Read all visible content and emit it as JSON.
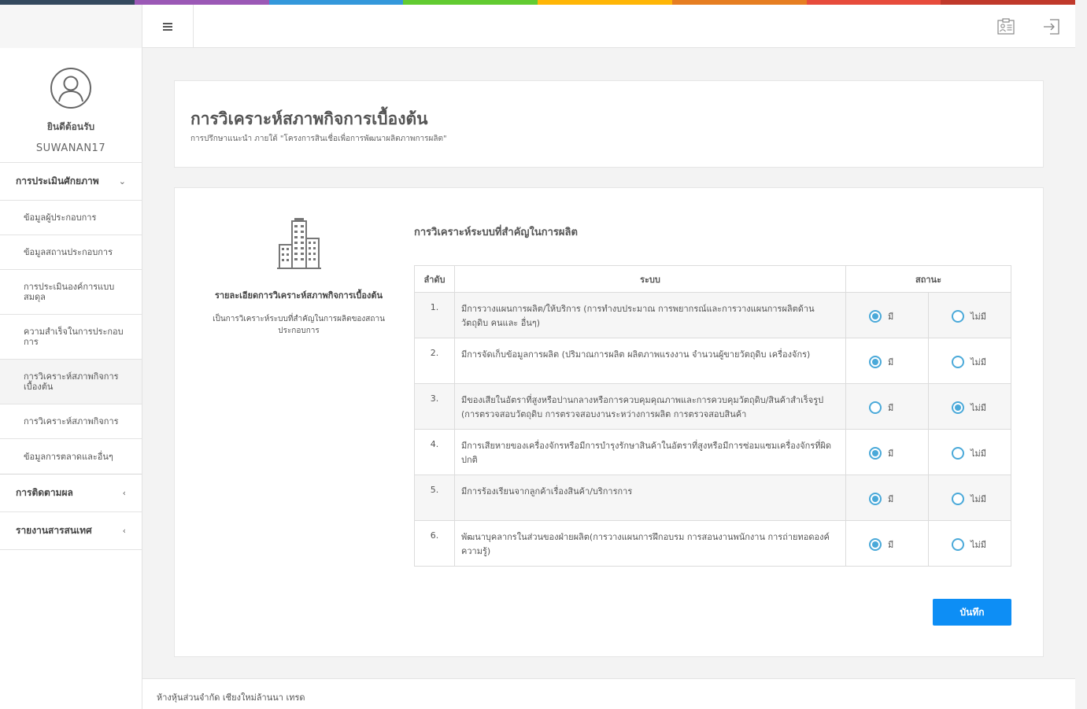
{
  "colors": {
    "stripe": [
      "#34495e",
      "#9b59b6",
      "#3498db",
      "#62cb31",
      "#ffb606",
      "#e67e22",
      "#e74c3c",
      "#c0392b"
    ],
    "accent": "#0d8ef5",
    "radio": "#4aa9d9"
  },
  "header": {
    "menu_icon": "hamburger-icon",
    "contact_icon": "id-card-icon",
    "logout_icon": "logout-icon"
  },
  "sidebar": {
    "welcome": "ยินดีต้อนรับ",
    "username": "SUWANAN17",
    "groups": [
      {
        "label": "การประเมินศักยภาพ",
        "chevron": "⌄",
        "items": [
          {
            "label": "ข้อมูลผู้ประกอบการ"
          },
          {
            "label": "ข้อมูลสถานประกอบการ"
          },
          {
            "label": "การประเมินองค์การแบบสมดุล"
          },
          {
            "label": "ความสำเร็จในการประกอบการ"
          },
          {
            "label": "การวิเคราะห์สภาพกิจการเบื้องต้น"
          },
          {
            "label": "การวิเคราะห์สภาพกิจการ"
          },
          {
            "label": "ข้อมูลการตลาดและอื่นๆ"
          }
        ]
      },
      {
        "label": "การติดตามผล",
        "chevron": "‹"
      },
      {
        "label": "รายงานสารสนเทศ",
        "chevron": "‹"
      }
    ]
  },
  "page": {
    "title": "การวิเคราะห์สภาพกิจการเบื้องต้น",
    "subtitle": "การปรึกษาแนะนำ ภายใต้ \"โครงการสินเชื่อเพื่อการพัฒนาผลิตภาพการผลิต\""
  },
  "detail": {
    "title": "รายละเอียดการวิเคราะห์สภาพกิจการเบื้องต้น",
    "description": "เป็นการวิเคราะห์ระบบที่สำคัญในการผลิตของสถานประกอบการ"
  },
  "section_title": "การวิเคราะห์ระบบที่สำคัญในการผลิต",
  "table": {
    "headers": {
      "order": "ลำดับ",
      "system": "ระบบ",
      "status": "สถานะ"
    },
    "yes_label": "มี",
    "no_label": "ไม่มี",
    "rows": [
      {
        "num": "1.",
        "text": "มีการวางแผนการผลิต/ให้บริการ (การทำงบประมาณ การพยากรณ์และการวางแผนการผลิตด้าน วัตถุดิบ คนและ อื่นๆ)",
        "selected": "yes"
      },
      {
        "num": "2.",
        "text": "มีการจัดเก็บข้อมูลการผลิต (ปริมาณการผลิต ผลิตภาพแรงงาน จำนวนผู้ขายวัตถุดิบ เครื่องจักร)",
        "selected": "yes"
      },
      {
        "num": "3.",
        "text": "มีของเสียในอัตราที่สูงหรือปานกลางหรือการควบคุมคุณภาพและการควบคุมวัตถุดิบ/สินค้าสำเร็จรูป (การตรวจสอบวัตถุดิบ การตรวจสอบงานระหว่างการผลิต การตรวจสอบสินค้า",
        "selected": "no"
      },
      {
        "num": "4.",
        "text": "มีการเสียหายของเครื่องจักรหรือมีการบำรุงรักษาสินค้าในอัตราที่สูงหรือมีการซ่อมแซมเครื่องจักรที่ผิดปกติ",
        "selected": "yes"
      },
      {
        "num": "5.",
        "text": "มีการร้องเรียนจากลูกค้าเรื่องสินค้า/บริการการ",
        "selected": "yes"
      },
      {
        "num": "6.",
        "text": "พัฒนาบุคลากรในส่วนของฝ่ายผลิต(การวางแผนการฝึกอบรม การสอนงานพนักงาน การถ่ายทอดองค์ความรู้)",
        "selected": "yes"
      }
    ]
  },
  "save_label": "บันทึก",
  "footer_text": "ห้างหุ้นส่วนจำกัด เชียงใหม่ล้านนา เทรด"
}
